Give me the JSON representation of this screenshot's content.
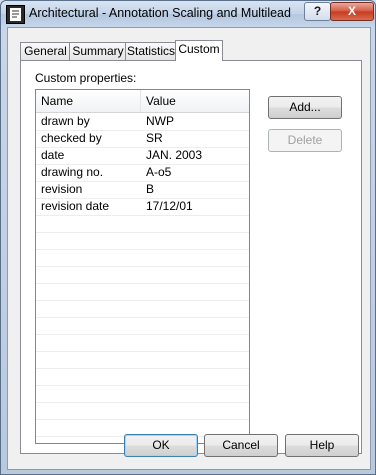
{
  "window": {
    "title": "Architectural - Annotation Scaling and Multilead...",
    "help_glyph": "?",
    "close_glyph": "X"
  },
  "tabs": [
    {
      "label": "General",
      "active": false
    },
    {
      "label": "Summary",
      "active": false
    },
    {
      "label": "Statistics",
      "active": false
    },
    {
      "label": "Custom",
      "active": true
    }
  ],
  "custom": {
    "group_label": "Custom properties:",
    "columns": [
      "Name",
      "Value"
    ],
    "rows": [
      {
        "name": "drawn by",
        "value": "NWP"
      },
      {
        "name": "checked by",
        "value": "SR"
      },
      {
        "name": "date",
        "value": "JAN. 2003"
      },
      {
        "name": "drawing no.",
        "value": "A-o5"
      },
      {
        "name": "revision",
        "value": "B"
      },
      {
        "name": "revision date",
        "value": "17/12/01"
      }
    ],
    "add_label": "Add...",
    "delete_label": "Delete"
  },
  "footer": {
    "ok_label": "OK",
    "cancel_label": "Cancel",
    "help_label": "Help"
  },
  "colors": {
    "title_bar": "#c2d3e8",
    "close_button": "#c43b1f",
    "dialog_bg": "#f0f0f0"
  }
}
